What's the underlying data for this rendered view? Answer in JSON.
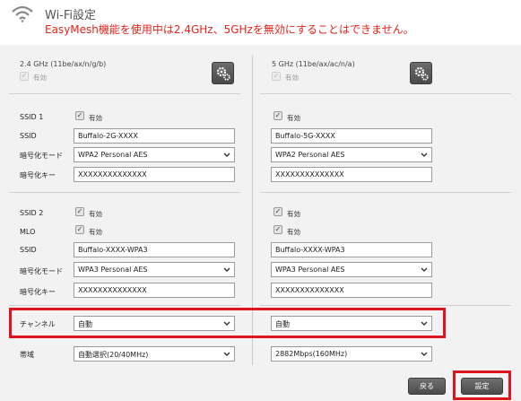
{
  "header": {
    "title": "Wi-Fi設定",
    "warning": "EasyMesh機能を使用中は2.4GHz、5GHzを無効にすることはできません。"
  },
  "band24": {
    "label": "2.4 GHz (11be/ax/n/g/b)",
    "enabled_label": "有効",
    "ssid1": {
      "enabled_label": "有効",
      "ssid": "Buffalo-2G-XXXX",
      "encryption": "WPA2 Personal AES",
      "key": "XXXXXXXXXXXXXX"
    },
    "ssid2": {
      "enabled_label": "有効",
      "mlo_label": "有効",
      "ssid": "Buffalo-XXXX-WPA3",
      "encryption": "WPA3 Personal AES",
      "key": "XXXXXXXXXXXXXX"
    },
    "channel": "自動",
    "bandwidth": "自動選択(20/40MHz)"
  },
  "band5": {
    "label": "5 GHz (11be/ax/ac/n/a)",
    "enabled_label": "有効",
    "ssid1": {
      "enabled_label": "有効",
      "ssid": "Buffalo-5G-XXXX",
      "encryption": "WPA2 Personal AES",
      "key": "XXXXXXXXXXXXXX"
    },
    "ssid2": {
      "enabled_label": "有効",
      "mlo_label": "有効",
      "ssid": "Buffalo-XXXX-WPA3",
      "encryption": "WPA3 Personal AES",
      "key": "XXXXXXXXXXXXXX"
    },
    "channel": "自動",
    "bandwidth": "2882Mbps(160MHz)"
  },
  "labels": {
    "ssid1": "SSID 1",
    "ssid": "SSID",
    "encryption_mode": "暗号化モード",
    "encryption_key": "暗号化キー",
    "ssid2": "SSID 2",
    "mlo": "MLO",
    "channel": "チャンネル",
    "bandwidth": "帯域"
  },
  "buttons": {
    "back": "戻る",
    "apply": "設定"
  },
  "colors": {
    "warning_text": "#e8231b",
    "highlight_border": "#e0141c",
    "button_bg": "#555555"
  },
  "icons": [
    "wifi-icon",
    "gear-icon",
    "checkbox-check-icon",
    "chevron-down-icon"
  ]
}
